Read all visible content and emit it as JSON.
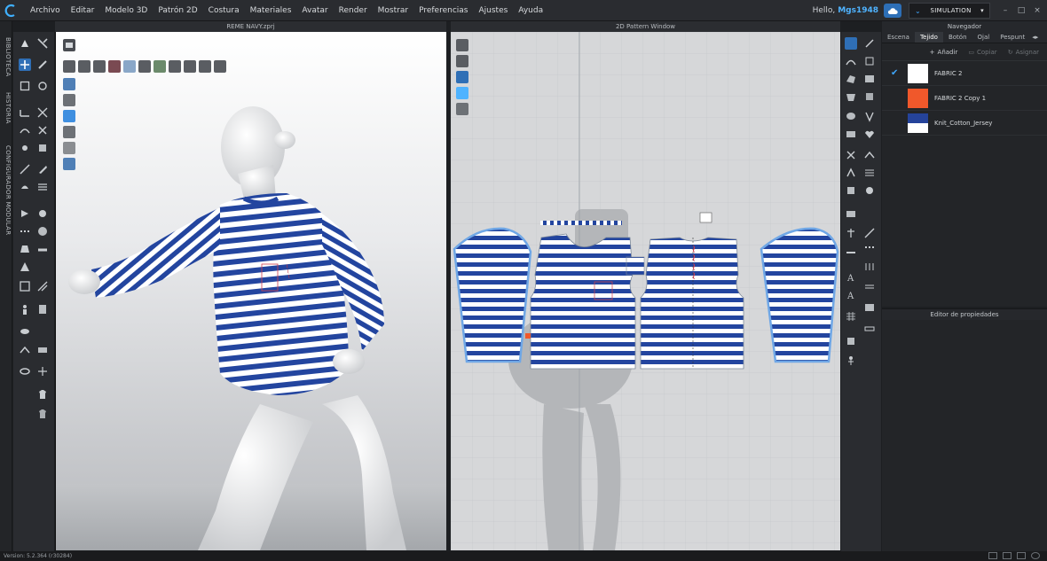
{
  "menu": [
    "Archivo",
    "Editar",
    "Modelo 3D",
    "Patrón 2D",
    "Costura",
    "Materiales",
    "Avatar",
    "Render",
    "Mostrar",
    "Preferencias",
    "Ajustes",
    "Ayuda"
  ],
  "user": {
    "greeting": "Hello,",
    "name": "Mgs1948"
  },
  "mode": {
    "label": "SIMULATION"
  },
  "side_tabs": [
    "BIBLIOTECA",
    "HISTORIA",
    "CONFIGURADOR MODULAR"
  ],
  "viewport3d": {
    "title": "REME NAVY.zprj"
  },
  "viewport2d": {
    "title": "2D Pattern Window"
  },
  "navigator": {
    "title": "Navegador",
    "tabs": [
      "Escena",
      "Tejido",
      "Botón",
      "Ojal",
      "Pespunt"
    ],
    "active_tab": "Tejido",
    "actions": {
      "add": "Añadir",
      "copy": "Copiar",
      "assign": "Asignar"
    },
    "fabrics": [
      {
        "name": "FABRIC 2",
        "color": "#ffffff",
        "selected": true
      },
      {
        "name": "FABRIC 2 Copy 1",
        "color": "#f0582b",
        "selected": false
      },
      {
        "name": "Knit_Cotton_Jersey",
        "color": "#25439a",
        "selected": false
      }
    ]
  },
  "properties": {
    "title": "Editor de propiedades"
  },
  "status": {
    "version": "Version: 5.2.364 (r30284)"
  },
  "colors": {
    "stripe_navy": "#23459f",
    "accent": "#3fa7ff",
    "pattern_outline": "#6fa7e6"
  }
}
